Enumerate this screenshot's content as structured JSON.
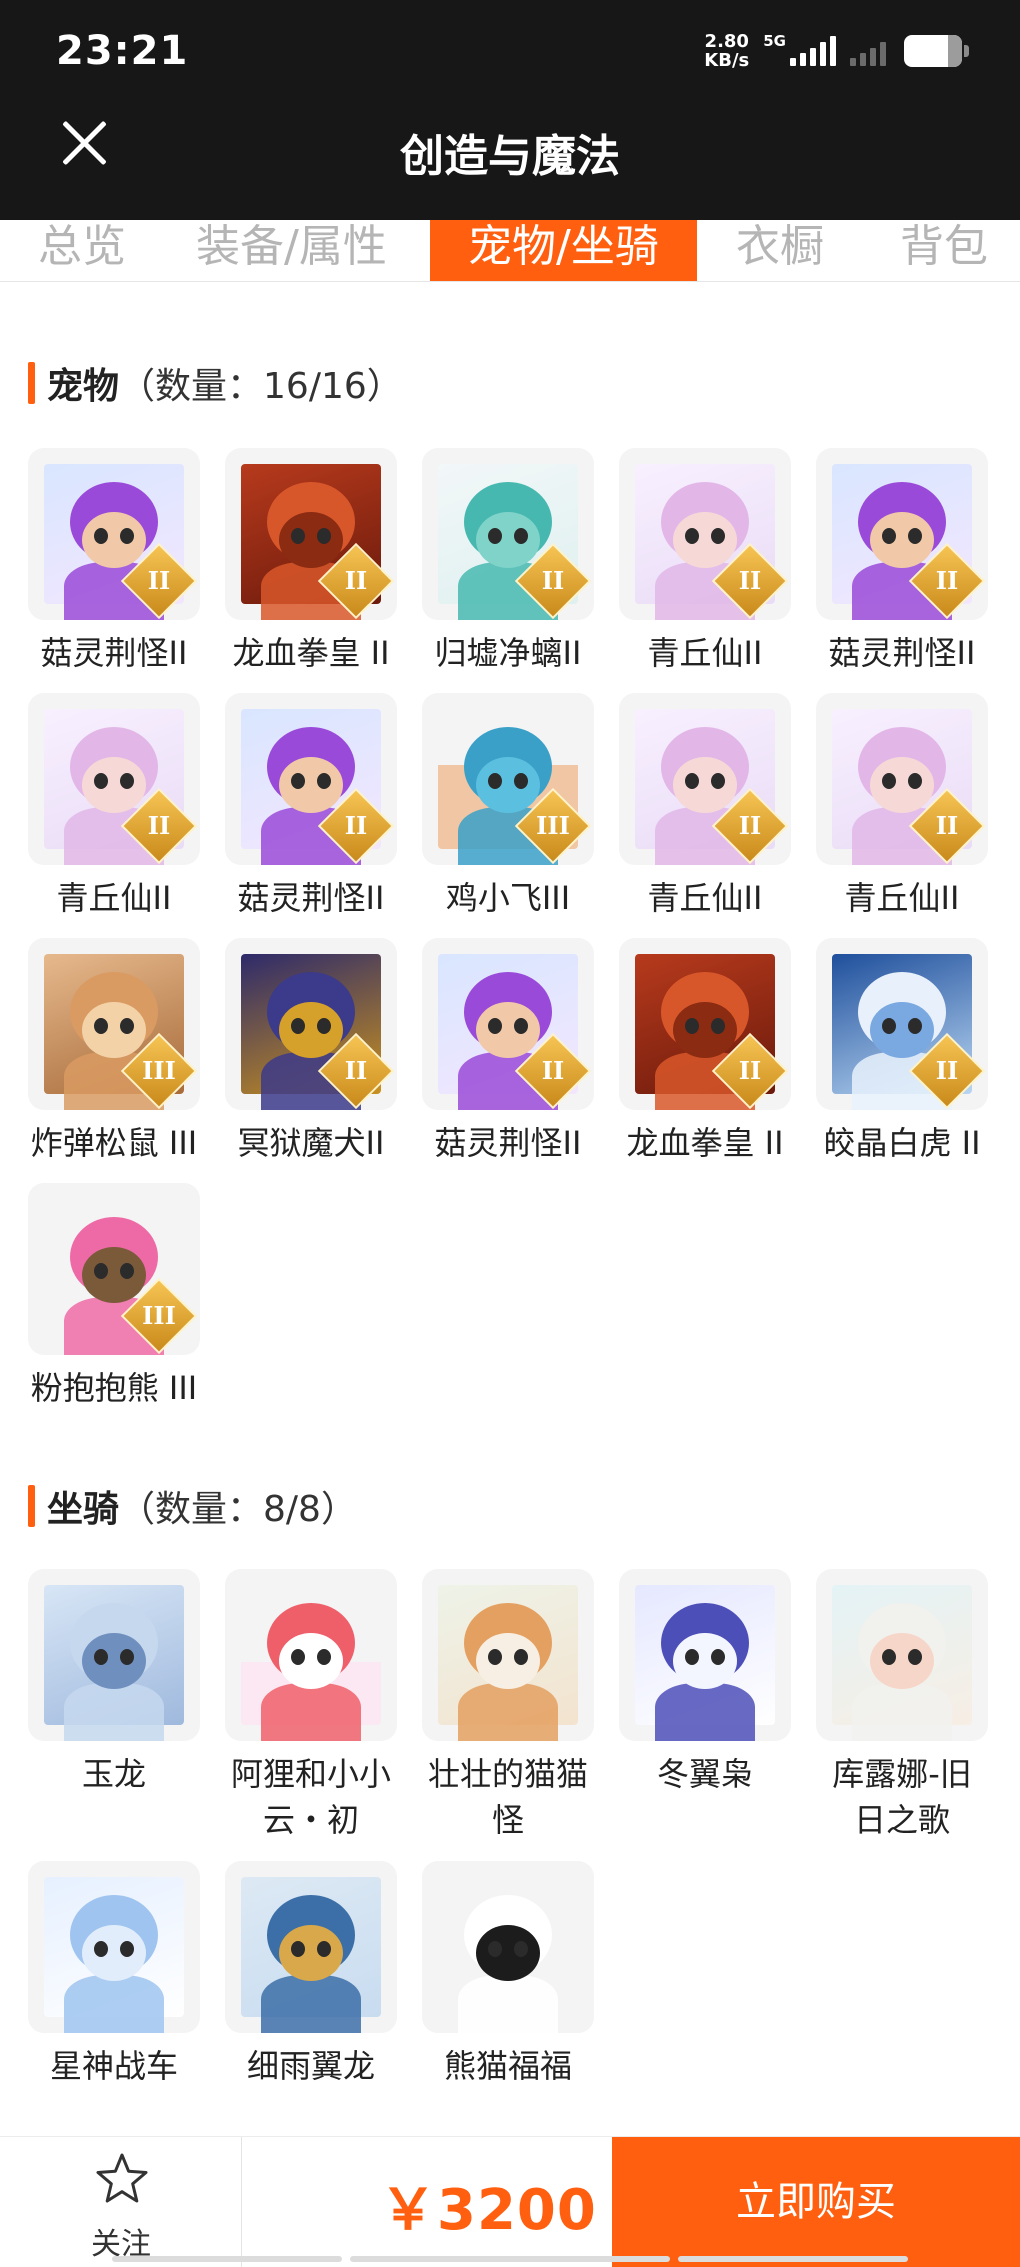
{
  "status_bar": {
    "time": "23:21",
    "net_speed_value": "2.80",
    "net_speed_unit": "KB/s",
    "network": "5G"
  },
  "header": {
    "title": "创造与魔法"
  },
  "tabs": [
    {
      "label": "总览"
    },
    {
      "label": "装备/属性"
    },
    {
      "label": "宠物/坐骑"
    },
    {
      "label": "衣橱"
    },
    {
      "label": "背包"
    }
  ],
  "pets": {
    "title": "宠物",
    "count_text": "（数量：16/16）",
    "items": [
      {
        "name": "菇灵荆怪II",
        "rank": "II",
        "icon": "mushroom-sprite-art"
      },
      {
        "name": "龙血拳皇 II",
        "rank": "II",
        "icon": "dragon-blood-fighter-art"
      },
      {
        "name": "归墟净螭II",
        "rank": "II",
        "icon": "sea-dragon-art"
      },
      {
        "name": "青丘仙II",
        "rank": "II",
        "icon": "fox-fairy-art"
      },
      {
        "name": "菇灵荆怪II",
        "rank": "II",
        "icon": "mushroom-sprite-art"
      },
      {
        "name": "青丘仙II",
        "rank": "II",
        "icon": "fox-fairy-art"
      },
      {
        "name": "菇灵荆怪II",
        "rank": "II",
        "icon": "mushroom-sprite-art"
      },
      {
        "name": "鸡小飞III",
        "rank": "III",
        "icon": "chick-art"
      },
      {
        "name": "青丘仙II",
        "rank": "II",
        "icon": "fox-fairy-art"
      },
      {
        "name": "青丘仙II",
        "rank": "II",
        "icon": "fox-fairy-art"
      },
      {
        "name": "炸弹松鼠 III",
        "rank": "III",
        "icon": "bomb-squirrel-art"
      },
      {
        "name": "冥狱魔犬II",
        "rank": "II",
        "icon": "hell-hound-art"
      },
      {
        "name": "菇灵荆怪II",
        "rank": "II",
        "icon": "mushroom-sprite-art"
      },
      {
        "name": "龙血拳皇 II",
        "rank": "II",
        "icon": "dragon-blood-fighter-art"
      },
      {
        "name": "皎晶白虎 II",
        "rank": "II",
        "icon": "white-tiger-art"
      },
      {
        "name": "粉抱抱熊 III",
        "rank": "III",
        "icon": "pink-bear-art"
      }
    ]
  },
  "mounts": {
    "title": "坐骑",
    "count_text": "（数量：8/8）",
    "items": [
      {
        "name": "玉龙",
        "icon": "jade-dragon-art"
      },
      {
        "name": "阿狸和小小云・初",
        "name_line1": "阿狸和小小",
        "name_line2": "云・初",
        "icon": "ahri-cloud-art"
      },
      {
        "name": "壮壮的猫猫怪",
        "name_line1": "壮壮的猫猫",
        "name_line2": "怪",
        "icon": "cat-monster-art"
      },
      {
        "name": "冬翼枭",
        "icon": "winter-owl-art"
      },
      {
        "name": "库露娜-旧日之歌",
        "name_line1": "库露娜-旧",
        "name_line2": "日之歌",
        "icon": "kuruna-art"
      },
      {
        "name": "星神战车",
        "icon": "star-chariot-art"
      },
      {
        "name": "细雨翼龙",
        "icon": "rain-wyvern-art"
      },
      {
        "name": "熊猫福福",
        "icon": "panda-art"
      }
    ]
  },
  "bottom_bar": {
    "follow_label": "关注",
    "price": "￥3200",
    "buy_label": "立即购买"
  },
  "colors": {
    "accent": "#ff5f0f",
    "header_bg": "#171717",
    "tile_bg": "#f4f4f4"
  }
}
